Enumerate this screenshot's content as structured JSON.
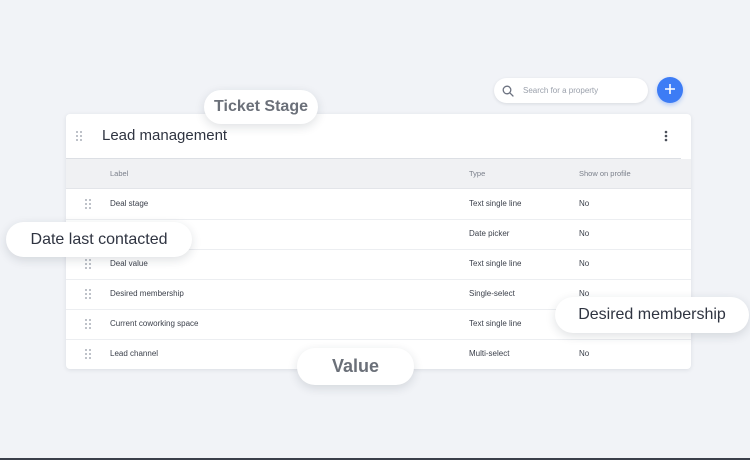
{
  "search": {
    "placeholder": "Search for a property",
    "icon": "search-icon"
  },
  "add_button": {
    "icon": "plus-icon",
    "color": "#3d7cf5"
  },
  "section": {
    "title": "Lead management"
  },
  "table": {
    "headers": {
      "label": "Label",
      "type": "Type",
      "show": "Show on profile"
    },
    "rows": [
      {
        "label": "Deal stage",
        "type": "Text single line",
        "show": "No"
      },
      {
        "label": "",
        "type": "Date picker",
        "show": "No"
      },
      {
        "label": "Deal value",
        "type": "Text single line",
        "show": "No"
      },
      {
        "label": "Desired membership",
        "type": "Single-select",
        "show": "No"
      },
      {
        "label": "Current coworking space",
        "type": "Text single line",
        "show": ""
      },
      {
        "label": "Lead channel",
        "type": "Multi-select",
        "show": "No"
      }
    ]
  },
  "pills": {
    "ticket_stage": "Ticket Stage",
    "date_last_contacted": "Date last contacted",
    "desired_membership": "Desired membership",
    "value": "Value"
  }
}
